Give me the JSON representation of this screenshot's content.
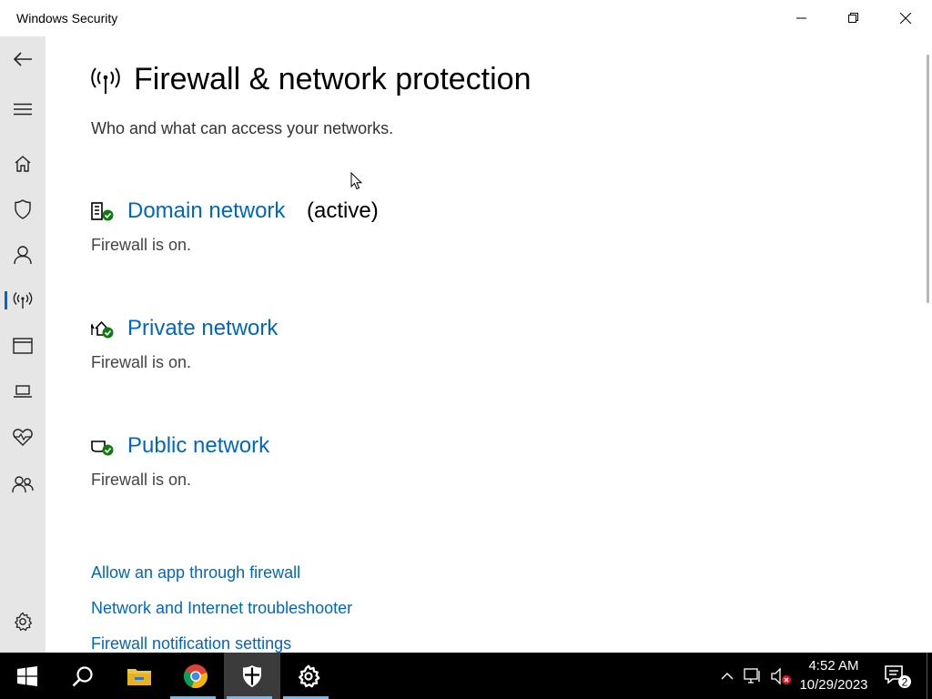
{
  "window": {
    "title": "Windows Security"
  },
  "page": {
    "title": "Firewall & network protection",
    "subtitle": "Who and what can access your networks."
  },
  "sidebar": {
    "items": [
      {
        "name": "back",
        "icon": "back-arrow-icon"
      },
      {
        "name": "menu",
        "icon": "hamburger-icon"
      },
      {
        "name": "home",
        "icon": "home-icon"
      },
      {
        "name": "virus-threat-protection",
        "icon": "shield-icon"
      },
      {
        "name": "account-protection",
        "icon": "person-icon"
      },
      {
        "name": "firewall-network-protection",
        "icon": "antenna-icon",
        "selected": true
      },
      {
        "name": "app-browser-control",
        "icon": "browser-window-icon"
      },
      {
        "name": "device-security",
        "icon": "laptop-icon"
      },
      {
        "name": "device-performance-health",
        "icon": "heart-pulse-icon"
      },
      {
        "name": "family-options",
        "icon": "family-icon"
      },
      {
        "name": "settings",
        "icon": "gear-icon"
      }
    ]
  },
  "networks": [
    {
      "name": "Domain network",
      "suffix": "(active)",
      "status": "Firewall is on.",
      "icon": "domain-building-icon"
    },
    {
      "name": "Private network",
      "suffix": "",
      "status": "Firewall is on.",
      "icon": "private-house-icon"
    },
    {
      "name": "Public network",
      "suffix": "",
      "status": "Firewall is on.",
      "icon": "public-cafe-icon"
    }
  ],
  "links": [
    "Allow an app through firewall",
    "Network and Internet troubleshooter",
    "Firewall notification settings"
  ],
  "taskbar": {
    "apps": [
      "start-icon",
      "search-icon",
      "file-explorer-icon",
      "chrome-icon",
      "windows-security-icon",
      "settings-icon"
    ],
    "time": "4:52 AM",
    "date": "10/29/2023",
    "notification_count": "2"
  },
  "colors": {
    "accent": "#0067c0",
    "sidebar_bg": "#e6e6e6",
    "ok_green": "#107c10",
    "taskbar_bg": "#000000"
  }
}
